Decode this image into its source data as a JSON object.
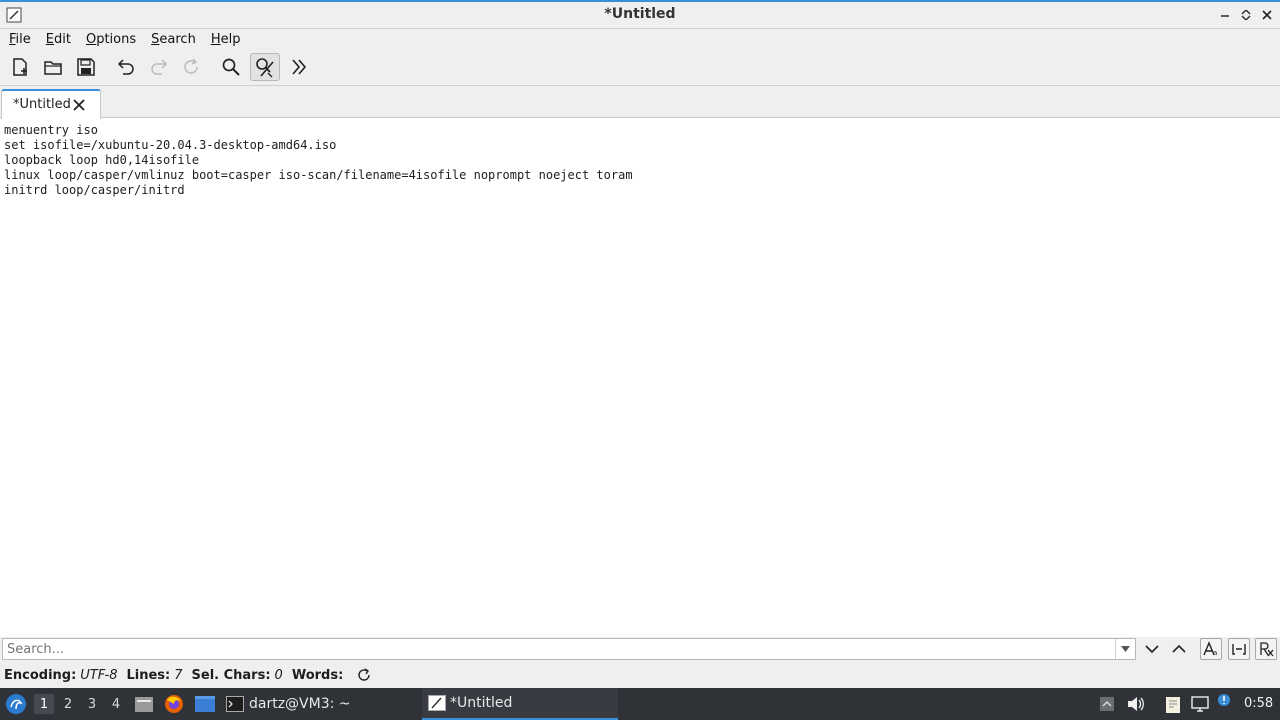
{
  "window": {
    "title": "*Untitled"
  },
  "menubar": {
    "items": [
      {
        "label_u": "F",
        "label_rest": "ile"
      },
      {
        "label_u": "E",
        "label_rest": "dit"
      },
      {
        "label_u": "O",
        "label_rest": "ptions"
      },
      {
        "label_u": "S",
        "label_rest": "earch"
      },
      {
        "label_u": "H",
        "label_rest": "elp"
      }
    ]
  },
  "toolbar": {
    "buttons": [
      "new-document-icon",
      "open-folder-icon",
      "save-icon",
      "undo-icon",
      "redo-icon",
      "reload-icon",
      "find-icon",
      "find-replace-icon",
      "more-icon"
    ]
  },
  "tabs": [
    {
      "label": "*Untitled"
    }
  ],
  "editor": {
    "lines": [
      "menuentry iso",
      "set isofile=/xubuntu-20.04.3-desktop-amd64.iso",
      "loopback loop hd0,14isofile",
      "linux loop/casper/vmlinuz boot=casper iso-scan/filename=4isofile noprompt noeject toram",
      "initrd loop/casper/initrd"
    ]
  },
  "search": {
    "placeholder": "Search...",
    "value": ""
  },
  "statusbar": {
    "encoding_label": "Encoding:",
    "encoding_value": "UTF-8",
    "lines_label": "Lines:",
    "lines_value": "7",
    "sel_label": "Sel. Chars:",
    "sel_value": "0",
    "words_label": "Words:"
  },
  "taskbar": {
    "workspaces": [
      "1",
      "2",
      "3",
      "4"
    ],
    "tasks": [
      {
        "label": "dartz@VM3: ~"
      },
      {
        "label": "*Untitled"
      }
    ],
    "clock": "0:58"
  },
  "colors": {
    "accent": "#3a8fd8",
    "panel": "#2f3237",
    "chrome": "#efefef"
  }
}
